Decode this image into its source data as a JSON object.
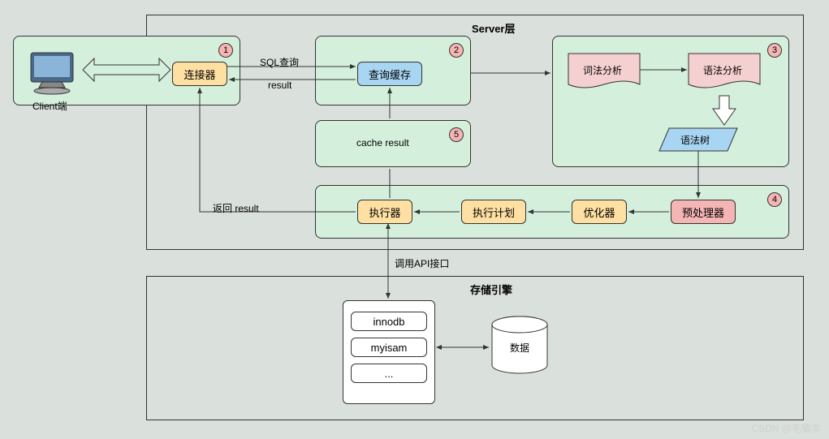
{
  "server_layer": "Server层",
  "storage_engine": "存储引擎",
  "client": "Client端",
  "connector": "连接器",
  "query_cache": "查询缓存",
  "lexical": "词法分析",
  "syntax": "语法分析",
  "syntax_tree": "语法树",
  "preprocessor": "预处理器",
  "optimizer": "优化器",
  "exec_plan": "执行计划",
  "executor": "执行器",
  "innodb": "innodb",
  "myisam": "myisam",
  "ellipsis": "...",
  "data_cyl": "数据",
  "labels": {
    "sql_query": "SQL查询",
    "result": "result",
    "cache_result": "cache result",
    "return_result": "返回 result",
    "api": "调用API接口"
  },
  "badges": {
    "b1": "1",
    "b2": "2",
    "b3": "3",
    "b4": "4",
    "b5": "5"
  },
  "watermark": "CSDN @毛嗑羊"
}
